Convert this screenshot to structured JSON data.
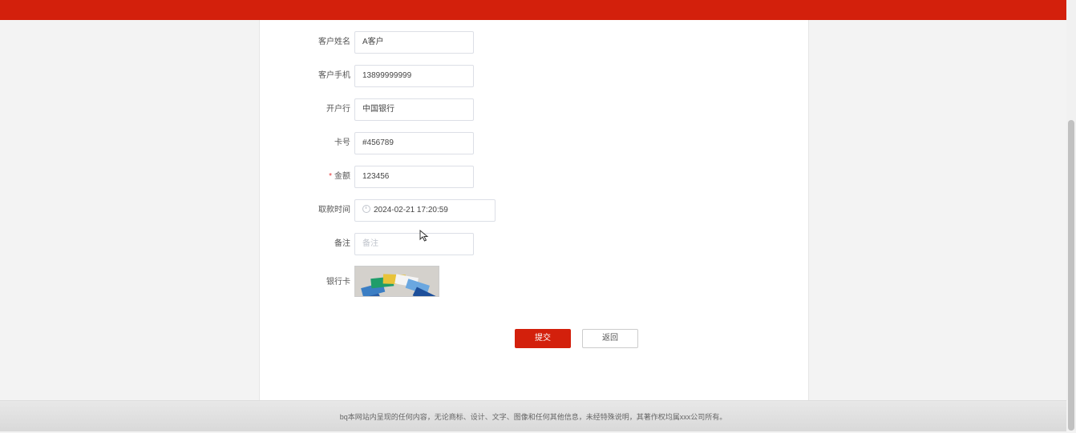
{
  "form": {
    "fields": [
      {
        "label": "客户姓名",
        "value": "A客户",
        "required": false
      },
      {
        "label": "客户手机",
        "value": "13899999999",
        "required": false
      },
      {
        "label": "开户行",
        "value": "中国银行",
        "required": false
      },
      {
        "label": "卡号",
        "value": "#456789",
        "required": false
      },
      {
        "label": "金额",
        "value": "123456",
        "required": true,
        "required_mark": "*"
      },
      {
        "label": "取款时间",
        "value": "2024-02-21 17:20:59",
        "required": false
      },
      {
        "label": "备注",
        "placeholder": "备注",
        "value": "",
        "required": false
      }
    ],
    "image_label": "银行卡"
  },
  "buttons": {
    "submit": "提交",
    "back": "返回"
  },
  "footer": {
    "text": "bq本网站内呈现的任何内容，无论商标、设计、文字、图像和任何其他信息，未经特殊说明，其著作权均属xxx公司所有。"
  },
  "colors": {
    "brand": "#d3200c",
    "background": "#f3f3f3"
  },
  "icons": {
    "datetime": "clock-icon",
    "pointer": "mouse-cursor-icon"
  }
}
